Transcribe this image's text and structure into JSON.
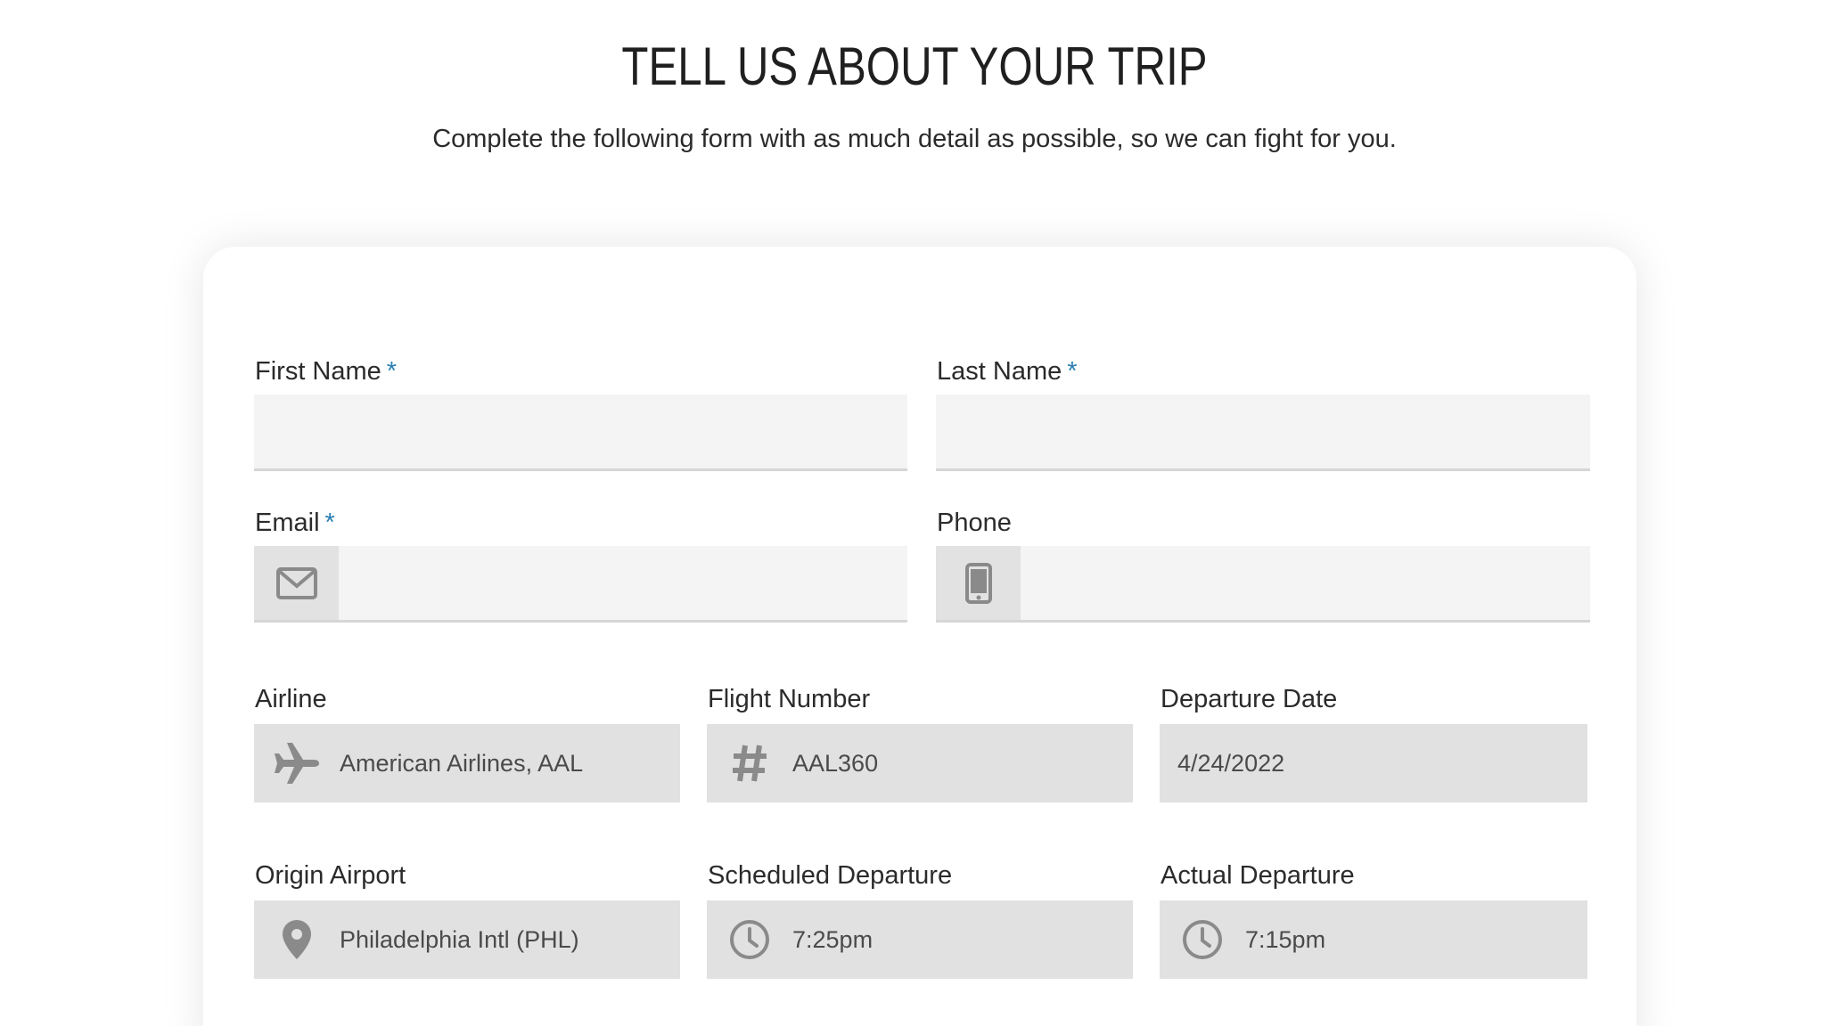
{
  "header": {
    "title": "TELL US ABOUT YOUR TRIP",
    "subtitle": "Complete the following form with as much detail as possible, so we can fight for you."
  },
  "form": {
    "required_marker": "*",
    "first_name": {
      "label": "First Name",
      "value": ""
    },
    "last_name": {
      "label": "Last Name",
      "value": ""
    },
    "email": {
      "label": "Email",
      "value": "",
      "icon": "envelope-icon"
    },
    "phone": {
      "label": "Phone",
      "value": "",
      "icon": "mobile-phone-icon"
    },
    "airline": {
      "label": "Airline",
      "value": "American Airlines, AAL",
      "icon": "airplane-icon"
    },
    "flight_number": {
      "label": "Flight Number",
      "value": "AAL360",
      "icon": "hash-icon"
    },
    "departure_date": {
      "label": "Departure Date",
      "value": "4/24/2022"
    },
    "origin_airport": {
      "label": "Origin Airport",
      "value": "Philadelphia Intl (PHL)",
      "icon": "map-pin-icon"
    },
    "scheduled_departure": {
      "label": "Scheduled Departure",
      "value": "7:25pm",
      "icon": "clock-icon"
    },
    "actual_departure": {
      "label": "Actual Departure",
      "value": "7:15pm",
      "icon": "clock-icon"
    }
  },
  "colors": {
    "accent": "#2a7fb3",
    "input_bg": "#f4f4f4",
    "filled_bg": "#e1e1e1",
    "icon_gray": "#8a8a8a"
  }
}
